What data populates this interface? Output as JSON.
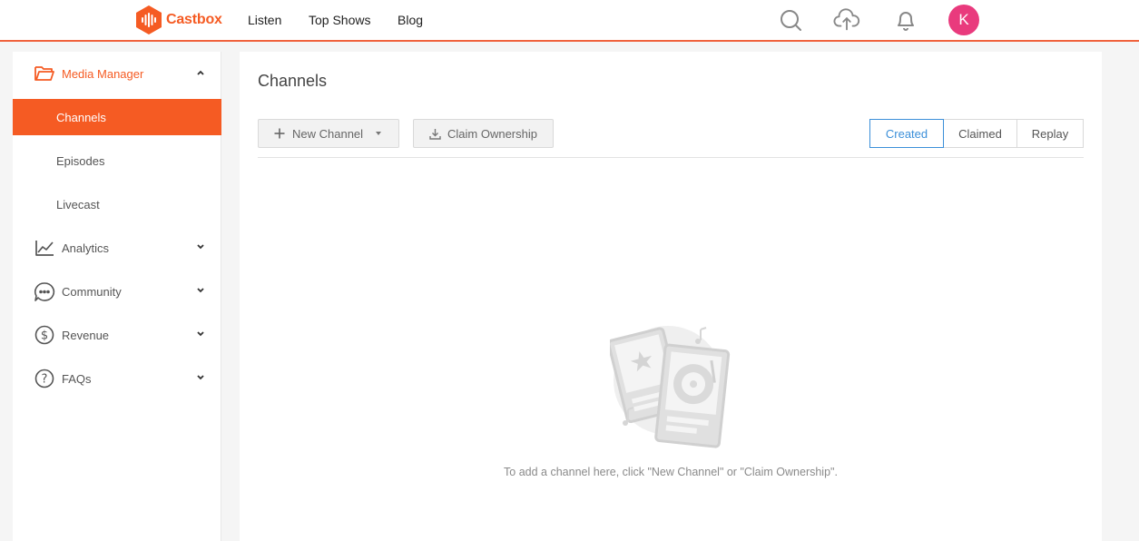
{
  "brand": {
    "name": "Castbox",
    "accent": "#f55b23"
  },
  "topnav": {
    "links": [
      {
        "label": "Listen"
      },
      {
        "label": "Top Shows"
      },
      {
        "label": "Blog"
      }
    ],
    "icons": [
      "search-icon",
      "upload-cloud-icon",
      "bell-icon"
    ],
    "avatar_initial": "K"
  },
  "sidebar": {
    "media_manager": {
      "label": "Media Manager",
      "icon": "folder-icon",
      "expanded": true
    },
    "sub_items": [
      {
        "label": "Channels",
        "active": true
      },
      {
        "label": "Episodes"
      },
      {
        "label": "Livecast"
      }
    ],
    "groups": [
      {
        "label": "Analytics",
        "icon": "chart-line-icon"
      },
      {
        "label": "Community",
        "icon": "chat-bubble-icon"
      },
      {
        "label": "Revenue",
        "icon": "dollar-icon"
      },
      {
        "label": "FAQs",
        "icon": "question-icon"
      }
    ]
  },
  "main": {
    "title": "Channels",
    "new_channel_label": "New Channel",
    "claim_ownership_label": "Claim Ownership",
    "tabs": [
      {
        "label": "Created",
        "active": true
      },
      {
        "label": "Claimed"
      },
      {
        "label": "Replay"
      }
    ],
    "empty_message": "To add a channel here, click \"New Channel\" or \"Claim Ownership\"."
  },
  "colors": {
    "accent": "#f55b23",
    "active_tab": "#3b8fd9",
    "avatar": "#e93a7d"
  }
}
